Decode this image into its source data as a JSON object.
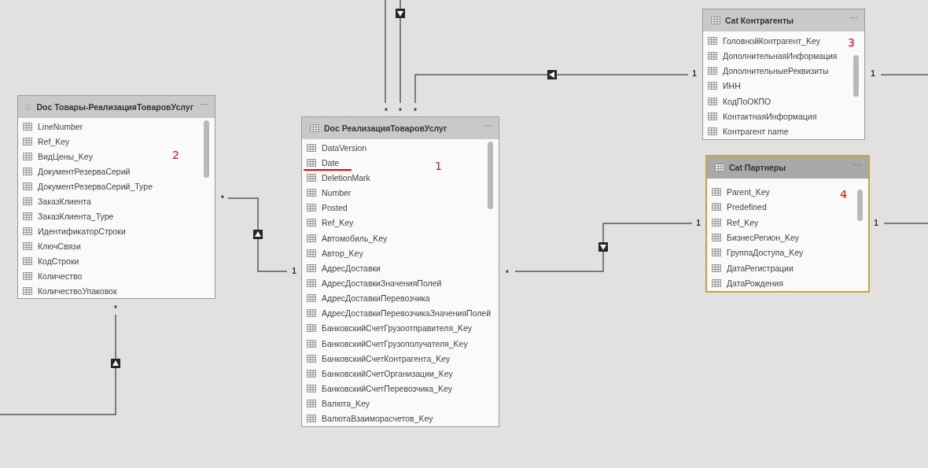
{
  "tables": [
    {
      "title": "Doc Товары-РеализацияТоваровУслуг",
      "menu": "···",
      "selected": false,
      "annotation": "2",
      "columns": [
        {
          "name": "LineNumber",
          "underlined": false
        },
        {
          "name": "Ref_Key",
          "underlined": false
        },
        {
          "name": "ВидЦены_Key",
          "underlined": false
        },
        {
          "name": "ДокументРезерваСерий",
          "underlined": false
        },
        {
          "name": "ДокументРезерваСерий_Type",
          "underlined": false
        },
        {
          "name": "ЗаказКлиента",
          "underlined": false
        },
        {
          "name": "ЗаказКлиента_Type",
          "underlined": false
        },
        {
          "name": "ИдентификаторСтроки",
          "underlined": false
        },
        {
          "name": "КлючСвязи",
          "underlined": false
        },
        {
          "name": "КодСтроки",
          "underlined": false
        },
        {
          "name": "Количество",
          "underlined": false
        },
        {
          "name": "КоличествоУпаковок",
          "underlined": false
        }
      ]
    },
    {
      "title": "Doc РеализацияТоваровУслуг",
      "menu": "···",
      "selected": false,
      "annotation": "1",
      "columns": [
        {
          "name": "DataVersion",
          "underlined": false
        },
        {
          "name": "Date",
          "underlined": true
        },
        {
          "name": "DeletionMark",
          "underlined": false
        },
        {
          "name": "Number",
          "underlined": false
        },
        {
          "name": "Posted",
          "underlined": false
        },
        {
          "name": "Ref_Key",
          "underlined": false
        },
        {
          "name": "Автомобиль_Key",
          "underlined": false
        },
        {
          "name": "Автор_Key",
          "underlined": false
        },
        {
          "name": "АдресДоставки",
          "underlined": false
        },
        {
          "name": "АдресДоставкиЗначенияПолей",
          "underlined": false
        },
        {
          "name": "АдресДоставкиПеревозчика",
          "underlined": false
        },
        {
          "name": "АдресДоставкиПеревозчикаЗначенияПолей",
          "underlined": false
        },
        {
          "name": "БанковскийСчетГрузоотправителя_Key",
          "underlined": false
        },
        {
          "name": "БанковскийСчетГрузополучателя_Key",
          "underlined": false
        },
        {
          "name": "БанковскийСчетКонтрагента_Key",
          "underlined": false
        },
        {
          "name": "БанковскийСчетОрганизации_Key",
          "underlined": false
        },
        {
          "name": "БанковскийСчетПеревозчика_Key",
          "underlined": false
        },
        {
          "name": "Валюта_Key",
          "underlined": false
        },
        {
          "name": "ВалютаВзаиморасчетов_Key",
          "underlined": false
        }
      ]
    },
    {
      "title": "Cat Контрагенты",
      "menu": "···",
      "selected": false,
      "annotation": "3",
      "columns": [
        {
          "name": "ГоловнойКонтрагент_Key",
          "underlined": false
        },
        {
          "name": "ДополнительнаяИнформация",
          "underlined": false
        },
        {
          "name": "ДополнительныеРеквизиты",
          "underlined": false
        },
        {
          "name": "ИНН",
          "underlined": false
        },
        {
          "name": "КодПоОКПО",
          "underlined": false
        },
        {
          "name": "КонтактнаяИнформация",
          "underlined": false
        },
        {
          "name": "Контрагент name",
          "underlined": false
        }
      ]
    },
    {
      "title": "Cat Партнеры",
      "menu": "···",
      "selected": true,
      "annotation": "4",
      "columns": [
        {
          "name": "Parent_Key",
          "underlined": false
        },
        {
          "name": "Predefined",
          "underlined": false
        },
        {
          "name": "Ref_Key",
          "underlined": false
        },
        {
          "name": "БизнесРегион_Key",
          "underlined": false
        },
        {
          "name": "ГруппаДоступа_Key",
          "underlined": false
        },
        {
          "name": "ДатаРегистрации",
          "underlined": false
        },
        {
          "name": "ДатаРождения",
          "underlined": false
        }
      ]
    }
  ],
  "relationships": [
    {
      "labels": [
        "*"
      ]
    },
    {
      "labels": [
        "*"
      ],
      "kind": "down"
    },
    {
      "labels": [
        "*",
        "1"
      ],
      "kind": "left"
    },
    {
      "labels": [
        "1"
      ]
    },
    {
      "labels": [
        "*",
        "1"
      ],
      "kind": "up"
    },
    {
      "labels": [
        "*"
      ],
      "kind": "up"
    },
    {
      "labels": [
        "*",
        "1"
      ],
      "kind": "down"
    },
    {
      "labels": [
        "1"
      ]
    }
  ]
}
